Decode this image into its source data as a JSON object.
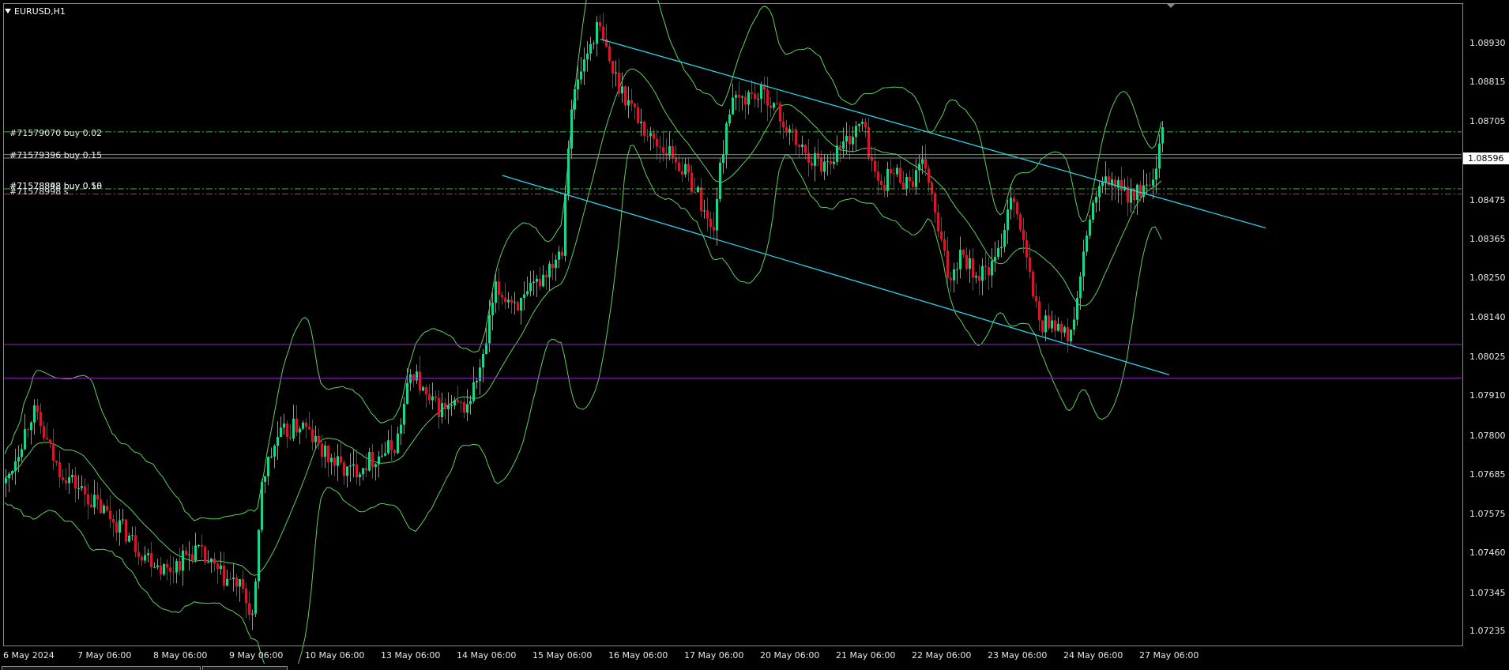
{
  "chart": {
    "symbol": "EURUSD,H1",
    "current_price": "1.08596",
    "orders": [
      {
        "label": "#71579070 buy 0.02",
        "price": 1.08675
      },
      {
        "label": "#71579396 buy 0.15",
        "price": 1.0861
      },
      {
        "label": "#71578842 buy 0.58",
        "price": 1.08512
      },
      {
        "label": "#71578898 buy 0.10",
        "price": 1.08512
      },
      {
        "label": "#71578998 s",
        "price": 1.08497
      }
    ],
    "price_axis": [
      "1.08930",
      "1.08815",
      "1.08705",
      "1.08596",
      "1.08475",
      "1.08365",
      "1.08250",
      "1.08140",
      "1.08025",
      "1.07910",
      "1.07800",
      "1.07685",
      "1.07575",
      "1.07460",
      "1.07345",
      "1.07235"
    ],
    "time_axis": [
      "6 May 2024",
      "7 May 06:00",
      "8 May 06:00",
      "9 May 06:00",
      "10 May 06:00",
      "13 May 06:00",
      "14 May 06:00",
      "15 May 06:00",
      "16 May 06:00",
      "17 May 06:00",
      "20 May 06:00",
      "21 May 06:00",
      "22 May 06:00",
      "23 May 06:00",
      "24 May 06:00",
      "27 May 06:00"
    ],
    "colors": {
      "bull": "#1fd48a",
      "bear": "#d2182a",
      "bands": "#5fcf5f",
      "channel": "#2ad3e8",
      "support": "#a01ad6",
      "order_line": "#3fb83f",
      "sl_line": "#d23a1a"
    }
  },
  "chart_data": {
    "type": "candlestick",
    "symbol": "EURUSD",
    "timeframe": "H1",
    "ylim": [
      1.0718,
      1.0903
    ],
    "horizontal_levels": [
      1.08067,
      1.0797
    ],
    "channel_upper": [
      {
        "x": "15 May 17:00",
        "y": 1.0894
      },
      {
        "x": "27 May 18:00",
        "y": 1.084
      }
    ],
    "channel_lower": [
      {
        "x": "14 May 21:00",
        "y": 1.0855
      },
      {
        "x": "27 May 06:00",
        "y": 1.0798
      }
    ],
    "approx_closes_by_day": [
      {
        "x": "6 May 2024",
        "close": 1.0767
      },
      {
        "x": "7 May 06:00",
        "close": 1.0765
      },
      {
        "x": "8 May 06:00",
        "close": 1.0745
      },
      {
        "x": "9 May 06:00",
        "close": 1.0734
      },
      {
        "x": "10 May 06:00",
        "close": 1.0772
      },
      {
        "x": "13 May 06:00",
        "close": 1.0786
      },
      {
        "x": "14 May 06:00",
        "close": 1.0816
      },
      {
        "x": "15 May 06:00",
        "close": 1.0877
      },
      {
        "x": "16 May 06:00",
        "close": 1.087
      },
      {
        "x": "17 May 06:00",
        "close": 1.0866
      },
      {
        "x": "20 May 06:00",
        "close": 1.0867
      },
      {
        "x": "21 May 06:00",
        "close": 1.0853
      },
      {
        "x": "22 May 06:00",
        "close": 1.084
      },
      {
        "x": "23 May 06:00",
        "close": 1.0824
      },
      {
        "x": "24 May 06:00",
        "close": 1.0842
      },
      {
        "x": "27 May 06:00",
        "close": 1.0859
      }
    ]
  }
}
